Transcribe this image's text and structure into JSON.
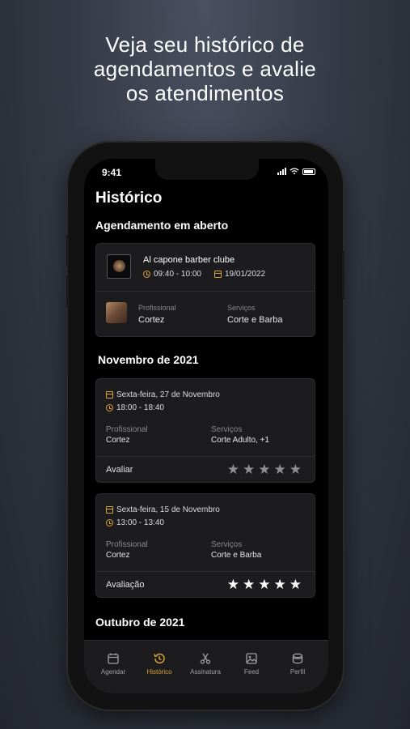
{
  "promo": {
    "line1": "Veja seu histórico de",
    "line2": "agendamentos e avalie",
    "line3": "os atendimentos"
  },
  "status_bar": {
    "time": "9:41"
  },
  "page": {
    "title": "Histórico"
  },
  "open_appointment": {
    "section_title": "Agendamento em aberto",
    "shop_name": "Al capone barber clube",
    "time": "09:40 - 10:00",
    "date": "19/01/2022",
    "professional_label": "Profissional",
    "professional": "Cortez",
    "services_label": "Serviços",
    "services": "Corte e Barba"
  },
  "month1": {
    "title": "Novembro de 2021"
  },
  "history": [
    {
      "date": "Sexta-feira, 27 de Novembro",
      "time": "18:00 - 18:40",
      "professional_label": "Profissional",
      "professional": "Cortez",
      "services_label": "Serviços",
      "services": "Corte Adulto, +1",
      "rating_label": "Avaliar",
      "rating": 0
    },
    {
      "date": "Sexta-feira, 15 de Novembro",
      "time": "13:00 - 13:40",
      "professional_label": "Profissional",
      "professional": "Cortez",
      "services_label": "Serviços",
      "services": "Corte e Barba",
      "rating_label": "Avaliação",
      "rating": 5
    }
  ],
  "month2": {
    "title": "Outubro de 2021"
  },
  "tabbar": [
    {
      "label": "Agendar",
      "icon": "calendar-icon",
      "active": false
    },
    {
      "label": "Histórico",
      "icon": "history-icon",
      "active": true
    },
    {
      "label": "Assinatura",
      "icon": "scissors-icon",
      "active": false
    },
    {
      "label": "Feed",
      "icon": "image-icon",
      "active": false
    },
    {
      "label": "Perfil",
      "icon": "profile-icon",
      "active": false
    }
  ],
  "colors": {
    "accent": "#d9a13a",
    "star_empty": "#8e8e93",
    "star_filled": "#ffffff",
    "card_bg": "#1c1c1e"
  }
}
